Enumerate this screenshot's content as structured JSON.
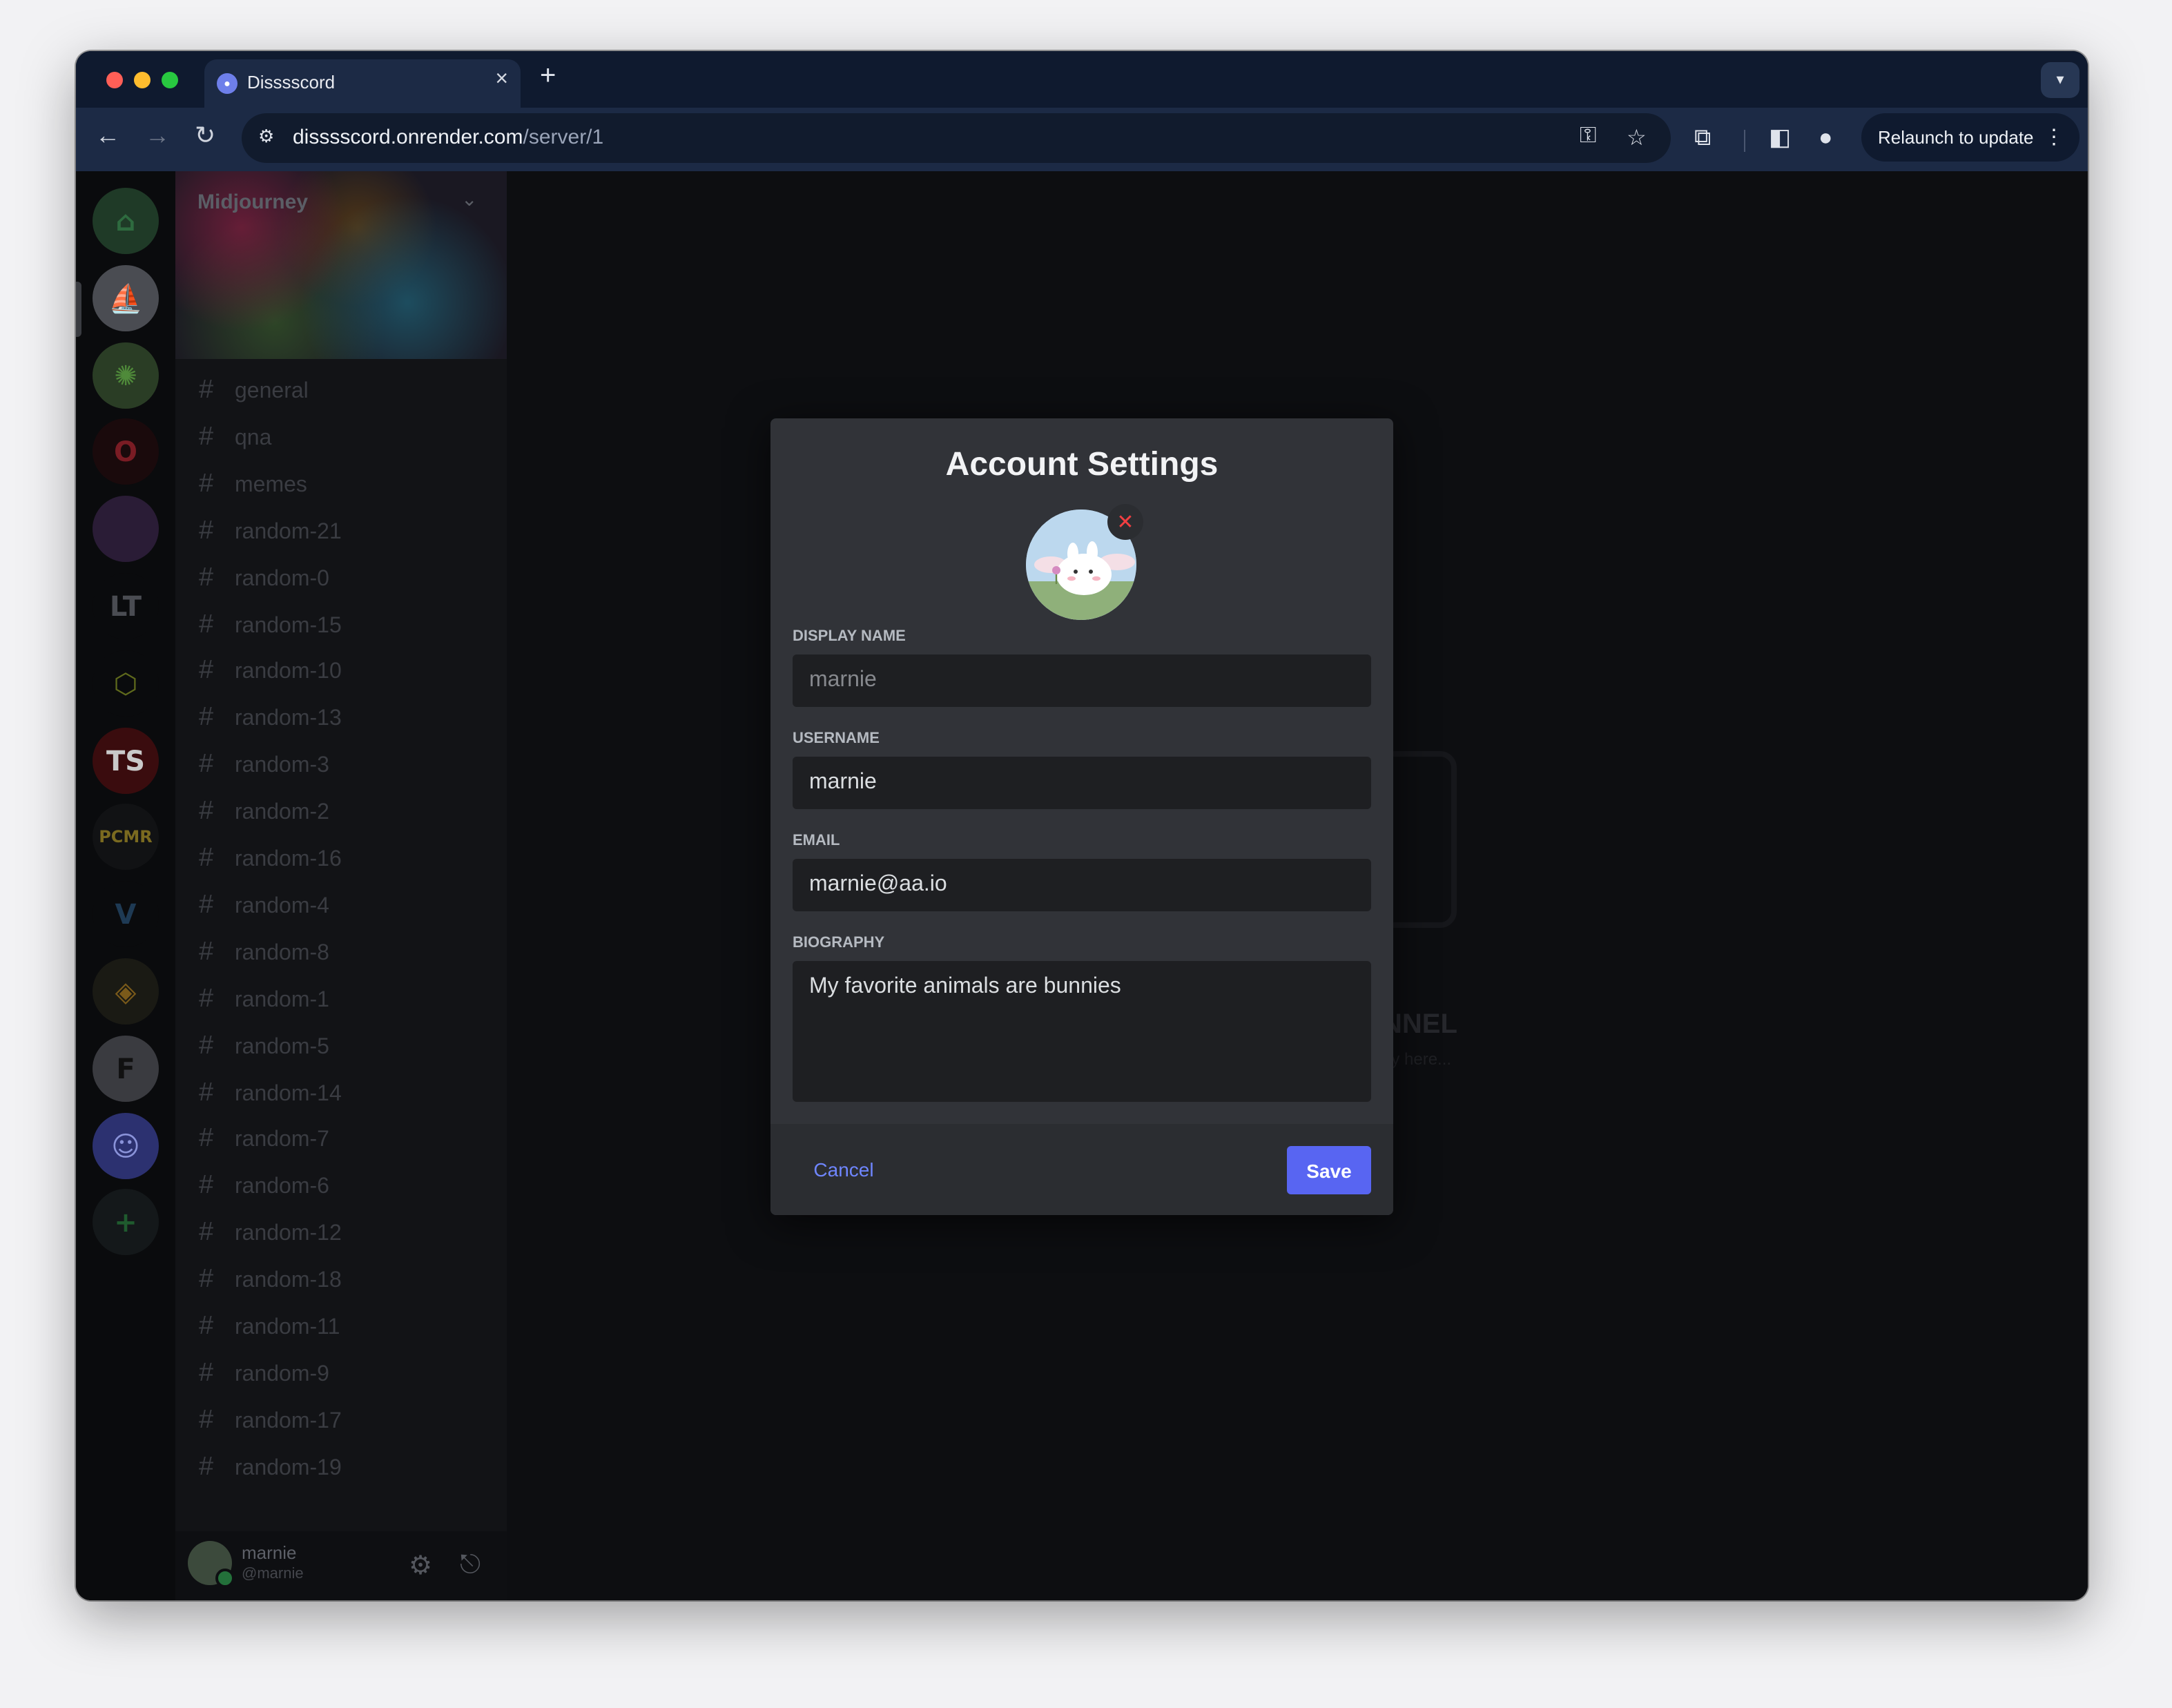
{
  "browser": {
    "tab_title": "Disssscord",
    "url_host": "disssscord.onrender.com",
    "url_path": "/server/1",
    "relaunch_label": "Relaunch to update"
  },
  "server": {
    "name": "Midjourney",
    "channels": [
      "general",
      "qna",
      "memes",
      "random-21",
      "random-0",
      "random-15",
      "random-10",
      "random-13",
      "random-3",
      "random-2",
      "random-16",
      "random-4",
      "random-8",
      "random-1",
      "random-5",
      "random-14",
      "random-7",
      "random-6",
      "random-12",
      "random-18",
      "random-11",
      "random-9",
      "random-17",
      "random-19"
    ]
  },
  "servers_sidebar": {
    "items": [
      {
        "name": "home-icon",
        "glyph": "⌂",
        "color": "#1f3a27",
        "fg": "#2e6b3f"
      },
      {
        "name": "server-midjourney",
        "glyph": "⛵",
        "color": "#4a4c52",
        "fg": "#1b1c1f"
      },
      {
        "name": "server-green",
        "glyph": "✺",
        "color": "#2a3d25",
        "fg": "#4f8a3a"
      },
      {
        "name": "server-opera",
        "glyph": "O",
        "color": "#1a0a0c",
        "fg": "#7a1c24"
      },
      {
        "name": "server-gradient",
        "glyph": "",
        "color": "#2a1c36",
        "fg": "#fff"
      },
      {
        "name": "server-lt",
        "glyph": "LT",
        "color": "#0a0b0d",
        "fg": "#4a4c52"
      },
      {
        "name": "server-cube",
        "glyph": "⬡",
        "color": "#0a0b0d",
        "fg": "#5f6a1c"
      },
      {
        "name": "server-ts",
        "glyph": "TS",
        "color": "#3a0c0e",
        "fg": "#c9c9c9"
      },
      {
        "name": "server-pcmr",
        "glyph": "PCMR",
        "color": "#111214",
        "fg": "#7a6a20"
      },
      {
        "name": "server-v",
        "glyph": "V",
        "color": "#0a0b0d",
        "fg": "#1e3a54"
      },
      {
        "name": "server-bnb",
        "glyph": "◈",
        "color": "#1a1a14",
        "fg": "#7a5a1a"
      },
      {
        "name": "server-f",
        "glyph": "F",
        "color": "#3a3b40",
        "fg": "#111"
      },
      {
        "name": "server-discord",
        "glyph": "☺",
        "color": "#2c3170",
        "fg": "#8a93d9"
      },
      {
        "name": "add-server-icon",
        "glyph": "+",
        "color": "#14181a",
        "fg": "#1f5a2e"
      }
    ]
  },
  "user_panel": {
    "name": "marnie",
    "handle": "@marnie"
  },
  "background_hint": {
    "title": "NNEL",
    "subtitle": "ay here..."
  },
  "modal": {
    "title": "Account Settings",
    "fields": {
      "display_name_label": "DISPLAY NAME",
      "display_name_placeholder": "marnie",
      "username_label": "USERNAME",
      "username_value": "marnie",
      "email_label": "EMAIL",
      "email_value": "marnie@aa.io",
      "biography_label": "BIOGRAPHY",
      "biography_value": "My favorite animals are bunnies"
    },
    "remove_avatar_glyph": "✕",
    "cancel_label": "Cancel",
    "save_label": "Save"
  }
}
